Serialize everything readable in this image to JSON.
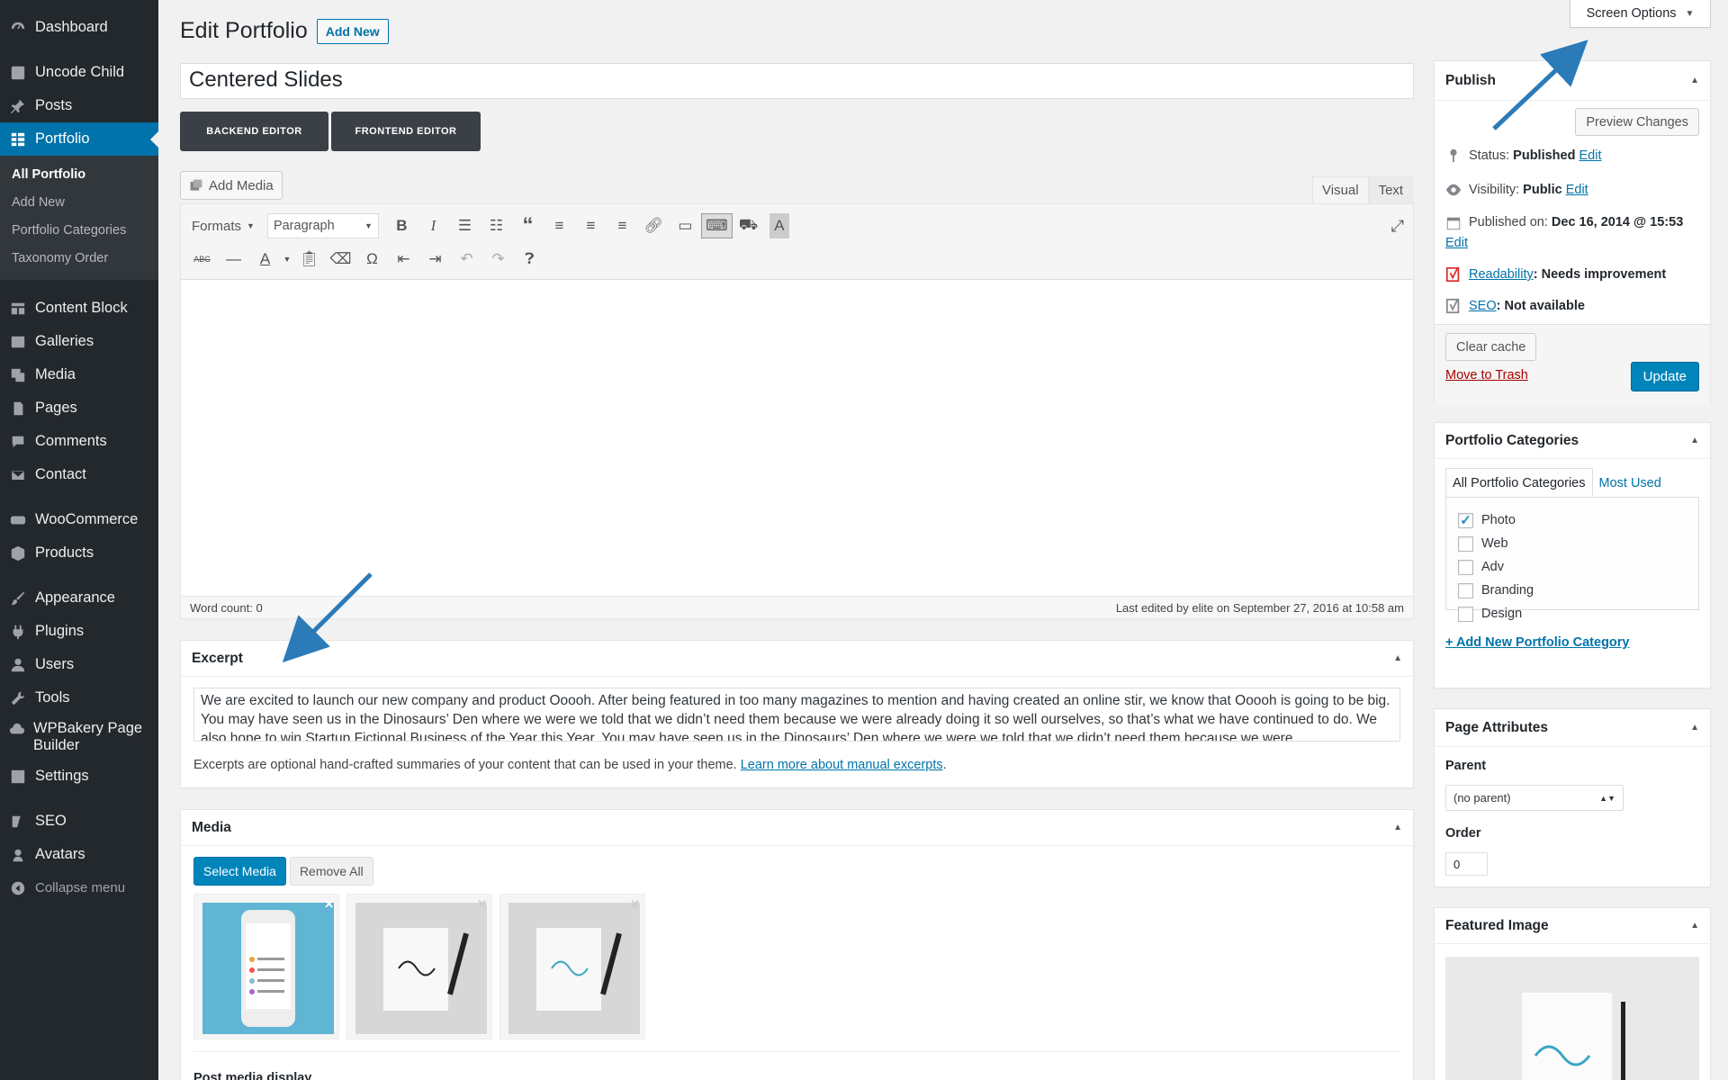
{
  "sidebar": {
    "items": [
      {
        "label": "Dashboard",
        "icon": "dashboard-icon"
      },
      {
        "label": "Uncode Child",
        "icon": "uncode-icon"
      },
      {
        "label": "Posts",
        "icon": "pin-icon"
      },
      {
        "label": "Portfolio",
        "icon": "grid-icon"
      },
      {
        "label": "Content Block",
        "icon": "blocks-icon"
      },
      {
        "label": "Galleries",
        "icon": "gallery-icon"
      },
      {
        "label": "Media",
        "icon": "media-icon"
      },
      {
        "label": "Pages",
        "icon": "pages-icon"
      },
      {
        "label": "Comments",
        "icon": "comment-icon"
      },
      {
        "label": "Contact",
        "icon": "mail-icon"
      },
      {
        "label": "WooCommerce",
        "icon": "woocommerce-icon"
      },
      {
        "label": "Products",
        "icon": "products-icon"
      },
      {
        "label": "Appearance",
        "icon": "brush-icon"
      },
      {
        "label": "Plugins",
        "icon": "plug-icon"
      },
      {
        "label": "Users",
        "icon": "user-icon"
      },
      {
        "label": "Tools",
        "icon": "wrench-icon"
      },
      {
        "label": "WPBakery Page Builder",
        "icon": "cloud-icon"
      },
      {
        "label": "Settings",
        "icon": "settings-icon"
      },
      {
        "label": "SEO",
        "icon": "yoast-icon"
      },
      {
        "label": "Avatars",
        "icon": "avatar-icon"
      },
      {
        "label": "Collapse menu",
        "icon": "collapse-icon"
      }
    ],
    "portfolio_sub": [
      "All Portfolio",
      "Add New",
      "Portfolio Categories",
      "Taxonomy Order"
    ]
  },
  "screen_options": "Screen Options",
  "header": {
    "title": "Edit Portfolio",
    "add_new": "Add New"
  },
  "post_title": "Centered Slides",
  "editor": {
    "backend": "BACKEND EDITOR",
    "frontend": "FRONTEND EDITOR",
    "add_media": "Add Media",
    "tab_visual": "Visual",
    "tab_text": "Text",
    "formats": "Formats",
    "paragraph": "Paragraph",
    "word_count": "Word count: 0",
    "last_edited": "Last edited by elite on September 27, 2016 at 10:58 am"
  },
  "excerpt": {
    "title": "Excerpt",
    "text": "We are excited to launch our new company and product Ooooh. After being featured in too many magazines to mention and having created an online stir, we know that Ooooh is going to be big. You may have seen us in the Dinosaurs’ Den where we were we told that we didn’t need them because we were already doing it so well ourselves, so that’s what we have continued to do. We also hope to win Startup Fictional Business of the Year this Year. You may have seen us in the Dinosaurs’ Den where we were we told that we didn’t need them because we were",
    "note": "Excerpts are optional hand-crafted summaries of your content that can be used in your theme. ",
    "note_link": "Learn more about manual excerpts",
    "note_end": "."
  },
  "media": {
    "title": "Media",
    "select": "Select Media",
    "remove": "Remove All",
    "post_media_display": "Post media display"
  },
  "publish": {
    "title": "Publish",
    "preview": "Preview Changes",
    "status_label": "Status: ",
    "status_value": "Published",
    "visibility_label": "Visibility: ",
    "visibility_value": "Public",
    "published_label": "Published on: ",
    "published_value": "Dec 16, 2014 @ 15:53",
    "edit": "Edit",
    "readability_link": "Readability",
    "readability_value": ": Needs improvement",
    "seo_link": "SEO",
    "seo_value": ": Not available",
    "clear_cache": "Clear cache",
    "trash": "Move to Trash",
    "update": "Update"
  },
  "categories": {
    "title": "Portfolio Categories",
    "tab_all": "All Portfolio Categories",
    "tab_most": "Most Used",
    "items": [
      {
        "label": "Photo",
        "checked": true
      },
      {
        "label": "Web",
        "checked": false
      },
      {
        "label": "Adv",
        "checked": false
      },
      {
        "label": "Branding",
        "checked": false
      },
      {
        "label": "Design",
        "checked": false
      }
    ],
    "add_new": "+ Add New Portfolio Category"
  },
  "page_attributes": {
    "title": "Page Attributes",
    "parent_label": "Parent",
    "parent_value": "(no parent)",
    "order_label": "Order",
    "order_value": "0"
  },
  "featured_image": {
    "title": "Featured Image"
  },
  "colors": {
    "accent": "#0073aa",
    "sidebar": "#23282d",
    "arrow": "#2b7bb9"
  }
}
